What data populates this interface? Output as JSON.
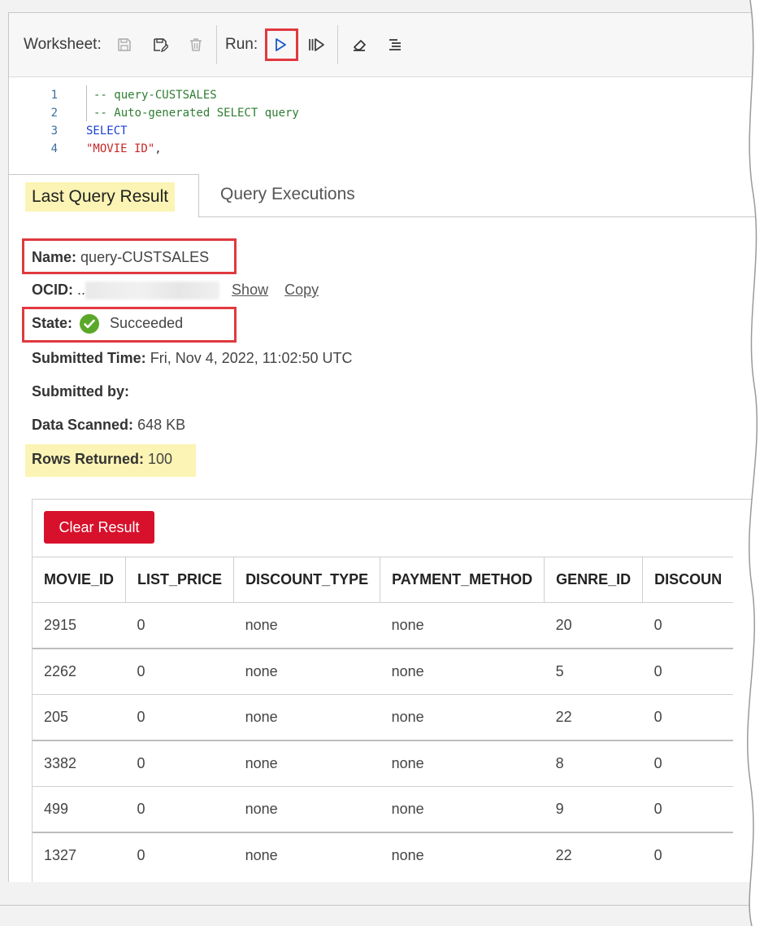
{
  "toolbar": {
    "worksheet_label": "Worksheet:",
    "run_label": "Run:",
    "icons": [
      "save-icon",
      "save-as-icon",
      "delete-icon",
      "run-icon",
      "run-script-icon",
      "clear-editor-icon",
      "format-icon"
    ]
  },
  "editor": {
    "lines": [
      {
        "num": "1",
        "text": "-- query-CUSTSALES",
        "kind": "comment"
      },
      {
        "num": "2",
        "text": "-- Auto-generated SELECT query",
        "kind": "comment"
      },
      {
        "num": "3",
        "text": "SELECT",
        "kind": "keyword"
      },
      {
        "num": "4",
        "text": "\"MOVIE ID\"",
        "suffix": ",",
        "kind": "string"
      }
    ]
  },
  "tabs": {
    "last_query_result": "Last Query Result",
    "query_executions": "Query Executions"
  },
  "details": {
    "name_label": "Name:",
    "name_value": "query-CUSTSALES",
    "ocid_label": "OCID:",
    "ocid_prefix": "..",
    "show_link": "Show",
    "copy_link": "Copy",
    "state_label": "State:",
    "state_value": "Succeeded",
    "submitted_time_label": "Submitted Time:",
    "submitted_time_value": "Fri, Nov 4, 2022, 11:02:50 UTC",
    "submitted_by_label": "Submitted by:",
    "data_scanned_label": "Data Scanned:",
    "data_scanned_value": "648 KB",
    "rows_returned_label": "Rows Returned:",
    "rows_returned_value": "100"
  },
  "results": {
    "clear_button": "Clear Result",
    "columns": [
      "MOVIE_ID",
      "LIST_PRICE",
      "DISCOUNT_TYPE",
      "PAYMENT_METHOD",
      "GENRE_ID",
      "DISCOUN"
    ],
    "rows": [
      [
        "2915",
        "0",
        "none",
        "none",
        "20",
        "0"
      ],
      [
        "2262",
        "0",
        "none",
        "none",
        "5",
        "0"
      ],
      [
        "205",
        "0",
        "none",
        "none",
        "22",
        "0"
      ],
      [
        "3382",
        "0",
        "none",
        "none",
        "8",
        "0"
      ],
      [
        "499",
        "0",
        "none",
        "none",
        "9",
        "0"
      ],
      [
        "1327",
        "0",
        "none",
        "none",
        "22",
        "0"
      ]
    ]
  },
  "colors": {
    "highlight_box": "#e0393e",
    "highlight_fill": "#fbf4b4",
    "clear_button": "#d7102b",
    "success": "#5aa829"
  }
}
